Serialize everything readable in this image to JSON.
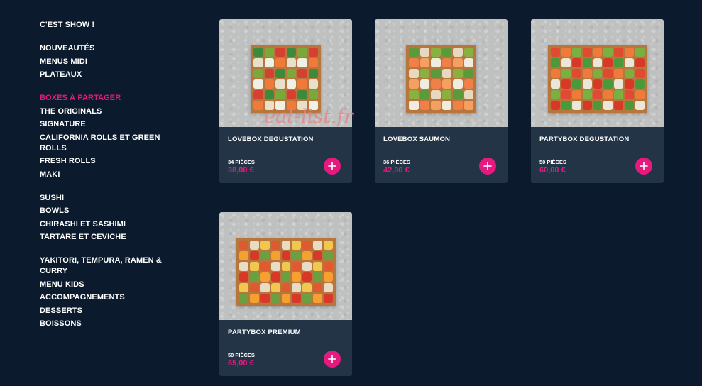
{
  "sidebar": {
    "groups": [
      [
        "C'EST SHOW !"
      ],
      [
        "NOUVEAUTÉS",
        "MENUS MIDI",
        "PLATEAUX"
      ],
      [
        "BOXES À PARTAGER",
        "THE ORIGINALS",
        "SIGNATURE",
        "CALIFORNIA ROLLS ET GREEN ROLLS",
        "FRESH ROLLS",
        "MAKI"
      ],
      [
        "SUSHI",
        "BOWLS",
        "CHIRASHI ET SASHIMI",
        "TARTARE ET CEVICHE"
      ],
      [
        "YAKITORI, TEMPURA, RAMEN & CURRY",
        "MENU KIDS",
        "ACCOMPAGNEMENTS",
        "DESSERTS",
        "BOISSONS"
      ]
    ],
    "active": "BOXES À PARTAGER"
  },
  "products": [
    {
      "name": "LOVEBOX DEGUSTATION",
      "pieces": "34 PIÈCES",
      "price": "38,00 €",
      "image_icon": "sushi-tray-image"
    },
    {
      "name": "LOVEBOX SAUMON",
      "pieces": "36 PIÈCES",
      "price": "42,00 €",
      "image_icon": "sushi-tray-image"
    },
    {
      "name": "PARTYBOX DEGUSTATION",
      "pieces": "50 PIÈCES",
      "price": "60,00 €",
      "image_icon": "sushi-tray-image"
    },
    {
      "name": "PARTYBOX PREMIUM",
      "pieces": "50 PIÈCES",
      "price": "65,00 €",
      "image_icon": "sushi-tray-image"
    }
  ],
  "add_icon": "plus-icon",
  "watermark": "eat-list.fr",
  "colors": {
    "background": "#0b1a2c",
    "card": "#243447",
    "accent": "#e6197e",
    "text": "#ffffff"
  }
}
